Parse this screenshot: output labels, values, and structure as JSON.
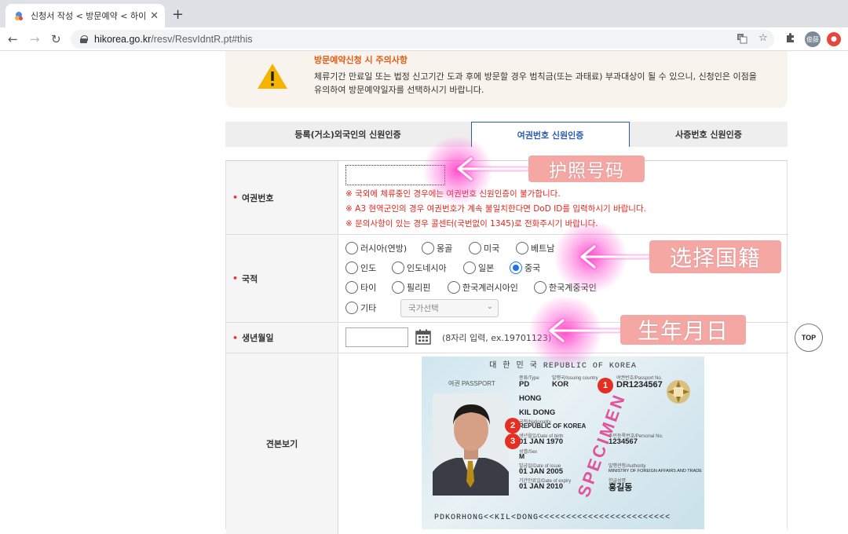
{
  "browser": {
    "tab_title": "신청서 작성 < 방문예약 < 하이코리아",
    "url_host": "hikorea.go.kr",
    "url_path": "/resv/ResvIdntR.pt#this",
    "profile_initials": "俊薛"
  },
  "notice": {
    "title": "방문예약신청 시 주의사항",
    "line1": "체류기간 만료일 또는 법정 신고기간 도과 후에 방문할 경우 범칙금(또는 과태료) 부과대상이 될 수 있으니, 신청인은 이점을",
    "line2": "유의하여 방문예약일자를 선택하시기 바랍니다."
  },
  "tabs": [
    {
      "label": "등록(거소)외국인의 신원인증",
      "active": false
    },
    {
      "label": "여권번호 신원인증",
      "active": true
    },
    {
      "label": "사증번호 신원인증",
      "active": false
    }
  ],
  "form": {
    "passport": {
      "label": "여권번호",
      "value": "",
      "warnings": [
        "※ 국외에 체류중인 경우에는 여권번호 신원인증이 불가합니다.",
        "※ A3 현역군인의 경우 여권번호가 계속 불일치한다면 DoD ID를 입력하시기 바랍니다.",
        "※ 문의사항이 있는 경우 콜센터(국번없이 1345)로 전화주시기 바랍니다."
      ]
    },
    "nationality": {
      "label": "국적",
      "options": [
        "러시아(연방)",
        "몽골",
        "미국",
        "베트남",
        "인도",
        "인도네시아",
        "일본",
        "중국",
        "타이",
        "필리핀",
        "한국계러시아인",
        "한국계중국인",
        "기타"
      ],
      "selected": "중국",
      "select_placeholder": "국가선택"
    },
    "dob": {
      "label": "생년월일",
      "value": "",
      "hint": "(8자리 입력, ex.19701123)"
    },
    "sample": {
      "label": "견본보기"
    }
  },
  "passport_sample": {
    "header": "대 한 민 국   REPUBLIC OF KOREA",
    "passport_word": "여권 PASSPORT",
    "type": "PD",
    "country_code": "KOR",
    "passport_no": "DR1234567",
    "surname": "HONG",
    "given_name": "KIL DONG",
    "nationality": "REPUBLIC OF KOREA",
    "dob": "01 JAN 1970",
    "personal_no": "1234567",
    "sex": "M",
    "issue_date": "01 JAN 2005",
    "authority": "MINISTRY OF FOREIGN AFFAIRS AND TRADE",
    "expiry_date": "01 JAN 2010",
    "korean_name": "홍길동",
    "mrz": "PDKORHONG<<KIL<DONG<<<<<<<<<<<<<<<<<<<<<<<<",
    "specimen": "SPECIMEN",
    "badges": [
      "1",
      "2",
      "3"
    ],
    "small_labels": {
      "type": "종류/Type",
      "country": "발행국/Issuing country",
      "passport_no": "여권번호/Passport No.",
      "nationality": "국적/Nationality",
      "dob": "생년월일/Date of birth",
      "personal_no": "주민등록번호/Personal No.",
      "sex": "성별/Sex",
      "issue": "발급일/Date of issue",
      "authority": "발행관청/Authority",
      "expiry": "기간만료일/Date of expiry",
      "name_kr": "한글성명"
    }
  },
  "annotations": {
    "passport": "护照号码",
    "nationality": "选择国籍",
    "dob": "生年月日"
  },
  "top_button": "TOP"
}
